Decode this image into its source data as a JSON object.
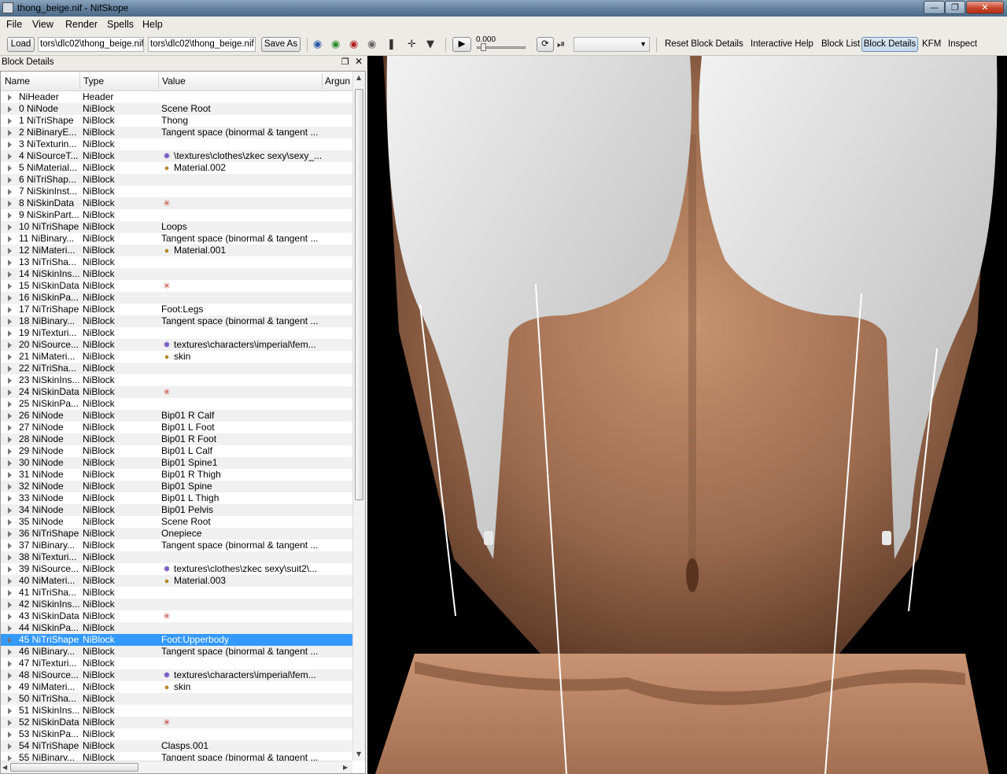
{
  "window": {
    "title": "thong_beige.nif - NifSkope"
  },
  "menu": [
    "File",
    "View",
    "Render",
    "Spells",
    "Help"
  ],
  "toolbar": {
    "load_label": "Load",
    "load_path": "tors\\dlc02\\thong_beige.nif",
    "save_path": "tors\\dlc02\\thong_beige.nif",
    "save_as_label": "Save As",
    "time_value": "0.000",
    "links": [
      "Reset Block Details",
      "Interactive Help",
      "Block List",
      "Block Details",
      "KFM",
      "Inspect"
    ],
    "active_link": "Block Details"
  },
  "panel": {
    "title": "Block Details",
    "columns": [
      "Name",
      "Type",
      "Value",
      "Argun"
    ]
  },
  "rows": [
    {
      "name": "NiHeader",
      "type": "Header",
      "value": "",
      "icon": ""
    },
    {
      "name": "0 NiNode",
      "type": "NiBlock",
      "value": "Scene Root",
      "icon": ""
    },
    {
      "name": "1 NiTriShape",
      "type": "NiBlock",
      "value": "Thong",
      "icon": ""
    },
    {
      "name": "2 NiBinaryE...",
      "type": "NiBlock",
      "value": "Tangent space (binormal & tangent ...",
      "icon": ""
    },
    {
      "name": "3 NiTexturin...",
      "type": "NiBlock",
      "value": "",
      "icon": ""
    },
    {
      "name": "4 NiSourceT...",
      "type": "NiBlock",
      "value": "\\textures\\clothes\\zkec sexy\\sexy_...",
      "icon": "texture"
    },
    {
      "name": "5 NiMaterial...",
      "type": "NiBlock",
      "value": "Material.002",
      "icon": "material"
    },
    {
      "name": "6 NiTriShap...",
      "type": "NiBlock",
      "value": "",
      "icon": ""
    },
    {
      "name": "7 NiSkinInst...",
      "type": "NiBlock",
      "value": "",
      "icon": ""
    },
    {
      "name": "8 NiSkinData",
      "type": "NiBlock",
      "value": "",
      "icon": "skin"
    },
    {
      "name": "9 NiSkinPart...",
      "type": "NiBlock",
      "value": "",
      "icon": ""
    },
    {
      "name": "10 NiTriShape",
      "type": "NiBlock",
      "value": "Loops",
      "icon": ""
    },
    {
      "name": "11 NiBinary...",
      "type": "NiBlock",
      "value": "Tangent space (binormal & tangent ...",
      "icon": ""
    },
    {
      "name": "12 NiMateri...",
      "type": "NiBlock",
      "value": "Material.001",
      "icon": "material"
    },
    {
      "name": "13 NiTriSha...",
      "type": "NiBlock",
      "value": "",
      "icon": ""
    },
    {
      "name": "14 NiSkinIns...",
      "type": "NiBlock",
      "value": "",
      "icon": ""
    },
    {
      "name": "15 NiSkinData",
      "type": "NiBlock",
      "value": "",
      "icon": "skin"
    },
    {
      "name": "16 NiSkinPa...",
      "type": "NiBlock",
      "value": "",
      "icon": ""
    },
    {
      "name": "17 NiTriShape",
      "type": "NiBlock",
      "value": "Foot:Legs",
      "icon": ""
    },
    {
      "name": "18 NiBinary...",
      "type": "NiBlock",
      "value": "Tangent space (binormal & tangent ...",
      "icon": ""
    },
    {
      "name": "19 NiTexturi...",
      "type": "NiBlock",
      "value": "",
      "icon": ""
    },
    {
      "name": "20 NiSource...",
      "type": "NiBlock",
      "value": "textures\\characters\\imperial\\fem...",
      "icon": "texture"
    },
    {
      "name": "21 NiMateri...",
      "type": "NiBlock",
      "value": "skin",
      "icon": "material"
    },
    {
      "name": "22 NiTriSha...",
      "type": "NiBlock",
      "value": "",
      "icon": ""
    },
    {
      "name": "23 NiSkinIns...",
      "type": "NiBlock",
      "value": "",
      "icon": ""
    },
    {
      "name": "24 NiSkinData",
      "type": "NiBlock",
      "value": "",
      "icon": "skin"
    },
    {
      "name": "25 NiSkinPa...",
      "type": "NiBlock",
      "value": "",
      "icon": ""
    },
    {
      "name": "26 NiNode",
      "type": "NiBlock",
      "value": "Bip01 R Calf",
      "icon": ""
    },
    {
      "name": "27 NiNode",
      "type": "NiBlock",
      "value": "Bip01 L Foot",
      "icon": ""
    },
    {
      "name": "28 NiNode",
      "type": "NiBlock",
      "value": "Bip01 R Foot",
      "icon": ""
    },
    {
      "name": "29 NiNode",
      "type": "NiBlock",
      "value": "Bip01 L Calf",
      "icon": ""
    },
    {
      "name": "30 NiNode",
      "type": "NiBlock",
      "value": "Bip01 Spine1",
      "icon": ""
    },
    {
      "name": "31 NiNode",
      "type": "NiBlock",
      "value": "Bip01 R Thigh",
      "icon": ""
    },
    {
      "name": "32 NiNode",
      "type": "NiBlock",
      "value": "Bip01 Spine",
      "icon": ""
    },
    {
      "name": "33 NiNode",
      "type": "NiBlock",
      "value": "Bip01 L Thigh",
      "icon": ""
    },
    {
      "name": "34 NiNode",
      "type": "NiBlock",
      "value": "Bip01 Pelvis",
      "icon": ""
    },
    {
      "name": "35 NiNode",
      "type": "NiBlock",
      "value": "Scene Root",
      "icon": ""
    },
    {
      "name": "36 NiTriShape",
      "type": "NiBlock",
      "value": "Onepiece",
      "icon": ""
    },
    {
      "name": "37 NiBinary...",
      "type": "NiBlock",
      "value": "Tangent space (binormal & tangent ...",
      "icon": ""
    },
    {
      "name": "38 NiTexturi...",
      "type": "NiBlock",
      "value": "",
      "icon": ""
    },
    {
      "name": "39 NiSource...",
      "type": "NiBlock",
      "value": "textures\\clothes\\zkec sexy\\suit2\\...",
      "icon": "texture"
    },
    {
      "name": "40 NiMateri...",
      "type": "NiBlock",
      "value": "Material.003",
      "icon": "material"
    },
    {
      "name": "41 NiTriSha...",
      "type": "NiBlock",
      "value": "",
      "icon": ""
    },
    {
      "name": "42 NiSkinIns...",
      "type": "NiBlock",
      "value": "",
      "icon": ""
    },
    {
      "name": "43 NiSkinData",
      "type": "NiBlock",
      "value": "",
      "icon": "skin"
    },
    {
      "name": "44 NiSkinPa...",
      "type": "NiBlock",
      "value": "",
      "icon": ""
    },
    {
      "name": "45 NiTriShape",
      "type": "NiBlock",
      "value": "Foot:Upperbody",
      "icon": "",
      "selected": true
    },
    {
      "name": "46 NiBinary...",
      "type": "NiBlock",
      "value": "Tangent space (binormal & tangent ...",
      "icon": ""
    },
    {
      "name": "47 NiTexturi...",
      "type": "NiBlock",
      "value": "",
      "icon": ""
    },
    {
      "name": "48 NiSource...",
      "type": "NiBlock",
      "value": "textures\\characters\\imperial\\fem...",
      "icon": "texture"
    },
    {
      "name": "49 NiMateri...",
      "type": "NiBlock",
      "value": "skin",
      "icon": "material"
    },
    {
      "name": "50 NiTriSha...",
      "type": "NiBlock",
      "value": "",
      "icon": ""
    },
    {
      "name": "51 NiSkinIns...",
      "type": "NiBlock",
      "value": "",
      "icon": ""
    },
    {
      "name": "52 NiSkinData",
      "type": "NiBlock",
      "value": "",
      "icon": "skin"
    },
    {
      "name": "53 NiSkinPa...",
      "type": "NiBlock",
      "value": "",
      "icon": ""
    },
    {
      "name": "54 NiTriShape",
      "type": "NiBlock",
      "value": "Clasps.001",
      "icon": ""
    },
    {
      "name": "55 NiBinary...",
      "type": "NiBlock",
      "value": "Tangent space (binormal & tangent ...",
      "icon": ""
    }
  ],
  "colors": {
    "selection": "#3399ff",
    "viewport_bg": "#000000"
  }
}
